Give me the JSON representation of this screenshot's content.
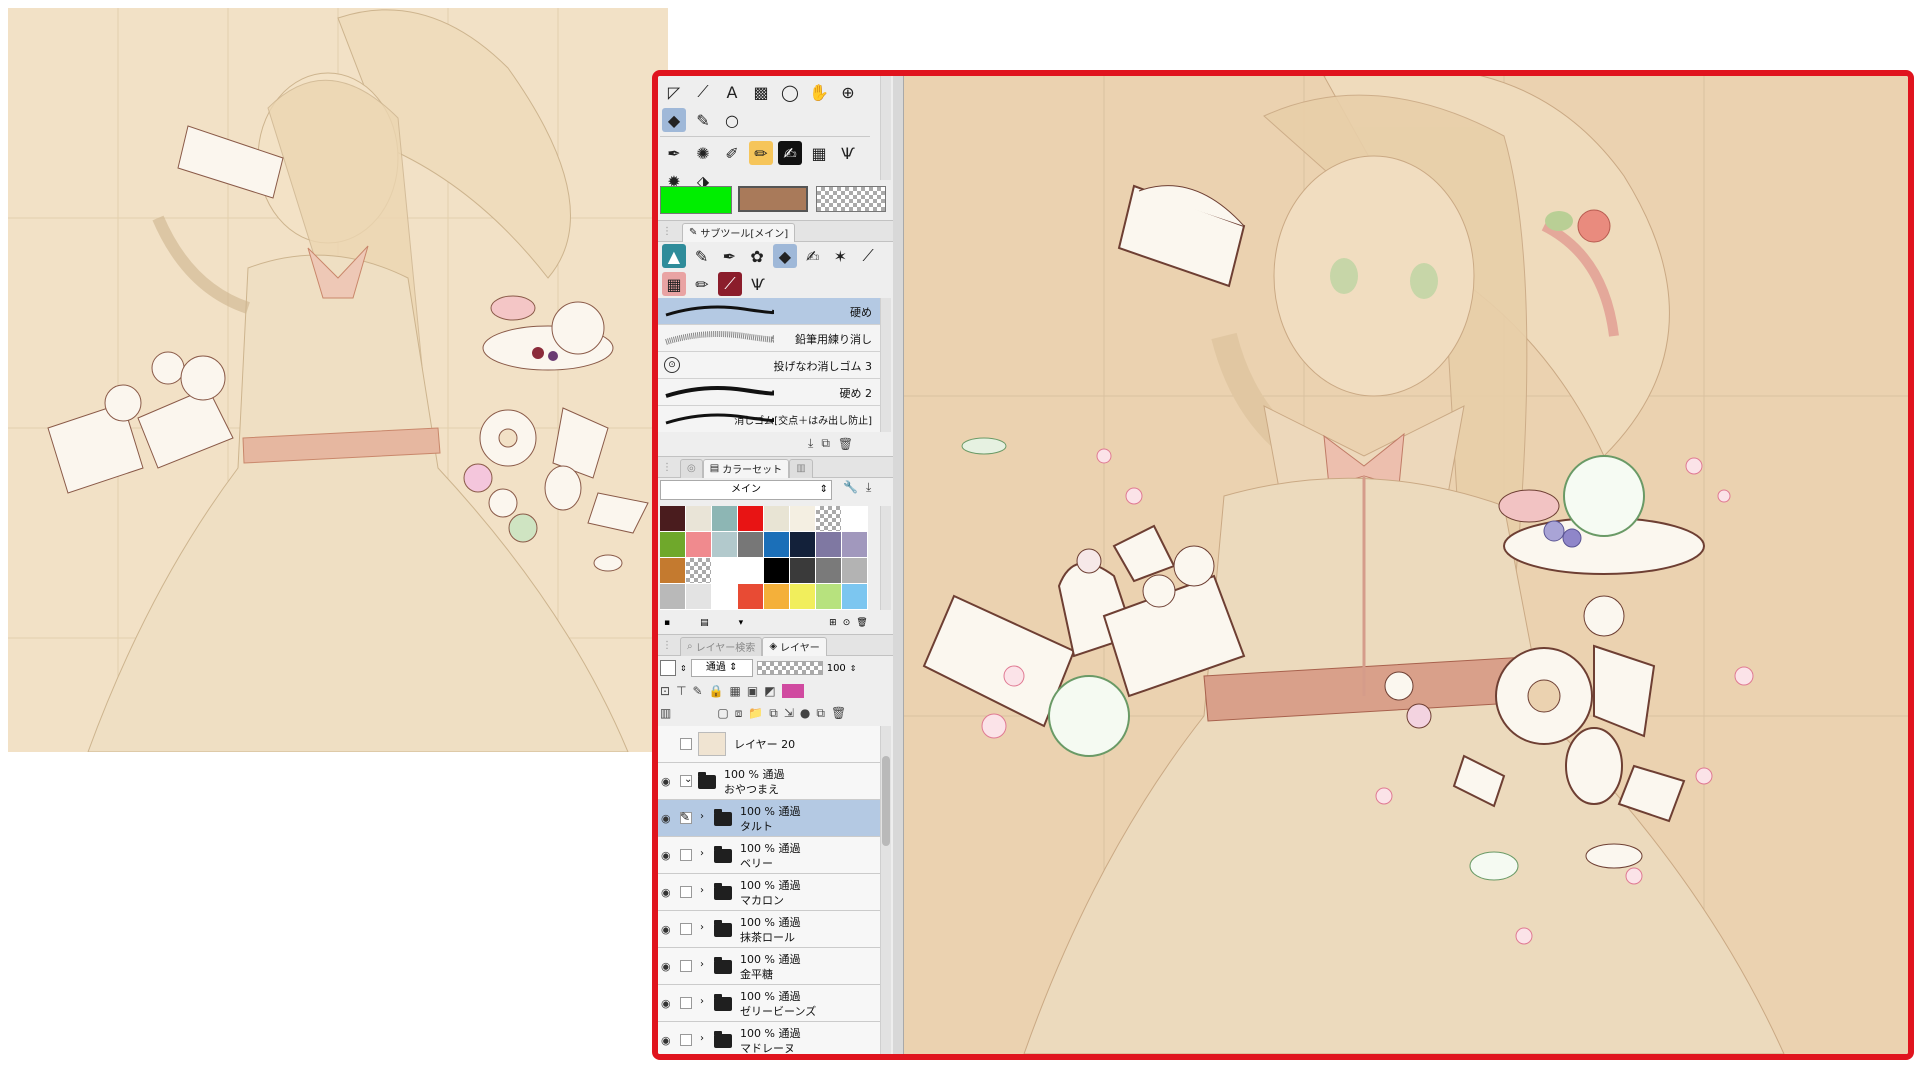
{
  "tool_palette": {
    "row1_icons": [
      "move-icon",
      "brush-stroke-icon",
      "text-tool-icon",
      "gradient-icon",
      "lasso-icon",
      "hand-icon",
      "operation-icon"
    ],
    "row2_icons": [
      "eraser-icon",
      "pen-icon",
      "ellipse-icon"
    ],
    "row3_icons": [
      "pen-nib-icon",
      "spray-icon",
      "brush-icon",
      "marker-icon",
      "ink-pen-icon",
      "frame-icon",
      "grass-icon"
    ],
    "row4_icons": [
      "sparkle-icon",
      "bird-icon"
    ]
  },
  "colors": {
    "main": "#00ee00",
    "sub": "#a97a5a",
    "accent": "#e0141e"
  },
  "subtool": {
    "tab_label": "サブツール[メイン]",
    "brushes": [
      {
        "label": "硬め"
      },
      {
        "label": "鉛筆用練り消し"
      },
      {
        "label": "投げなわ消しゴム 3"
      },
      {
        "label": "硬め 2"
      },
      {
        "label": "消しゴム[交点＋はみ出し防止]"
      }
    ]
  },
  "colorset": {
    "tab_label": "カラーセット",
    "set_name": "メイン",
    "swatches": [
      [
        "#4a1c1e",
        "#e9e4d7",
        "#8db6b4",
        "#e81414",
        "#e8e4d4",
        "#f4efe2",
        "checker",
        "#ffffff"
      ],
      [
        "#6fa82b",
        "#f08a8e",
        "#b2c9cc",
        "#777777",
        "#1b6fb8",
        "#13213a",
        "#7f78a2",
        "#a198bd"
      ],
      [
        "#c47a2f",
        "checker",
        "#ffffff",
        "#ffffff",
        "#000000",
        "#3a3a3a",
        "#7a7a7a",
        "#b3b3b3"
      ],
      [
        "#b9b9b9",
        "#e3e3e3",
        "#ffffff",
        "#e84b34",
        "#f4b03a",
        "#f1ee5c",
        "#b7e27e",
        "#7cc6f0"
      ]
    ]
  },
  "layers": {
    "tab_search": "レイヤー検索",
    "tab_layer": "レイヤー",
    "blend_mode": "通過",
    "opacity": "100",
    "items": [
      {
        "mode": "",
        "name": "レイヤー 20",
        "indent": 0,
        "type": "layer"
      },
      {
        "mode": "100 % 通過",
        "name": "おやつまえ",
        "indent": 0,
        "type": "folder-open"
      },
      {
        "mode": "100 % 通過",
        "name": "タルト",
        "indent": 1,
        "type": "folder",
        "selected": true
      },
      {
        "mode": "100 % 通過",
        "name": "ベリー",
        "indent": 1,
        "type": "folder"
      },
      {
        "mode": "100 % 通過",
        "name": "マカロン",
        "indent": 1,
        "type": "folder"
      },
      {
        "mode": "100 % 通過",
        "name": "抹茶ロール",
        "indent": 1,
        "type": "folder"
      },
      {
        "mode": "100 % 通過",
        "name": "金平糖",
        "indent": 1,
        "type": "folder"
      },
      {
        "mode": "100 % 通過",
        "name": "ゼリービーンズ",
        "indent": 1,
        "type": "folder"
      },
      {
        "mode": "100 % 通過",
        "name": "マドレーヌ",
        "indent": 1,
        "type": "folder"
      }
    ]
  }
}
